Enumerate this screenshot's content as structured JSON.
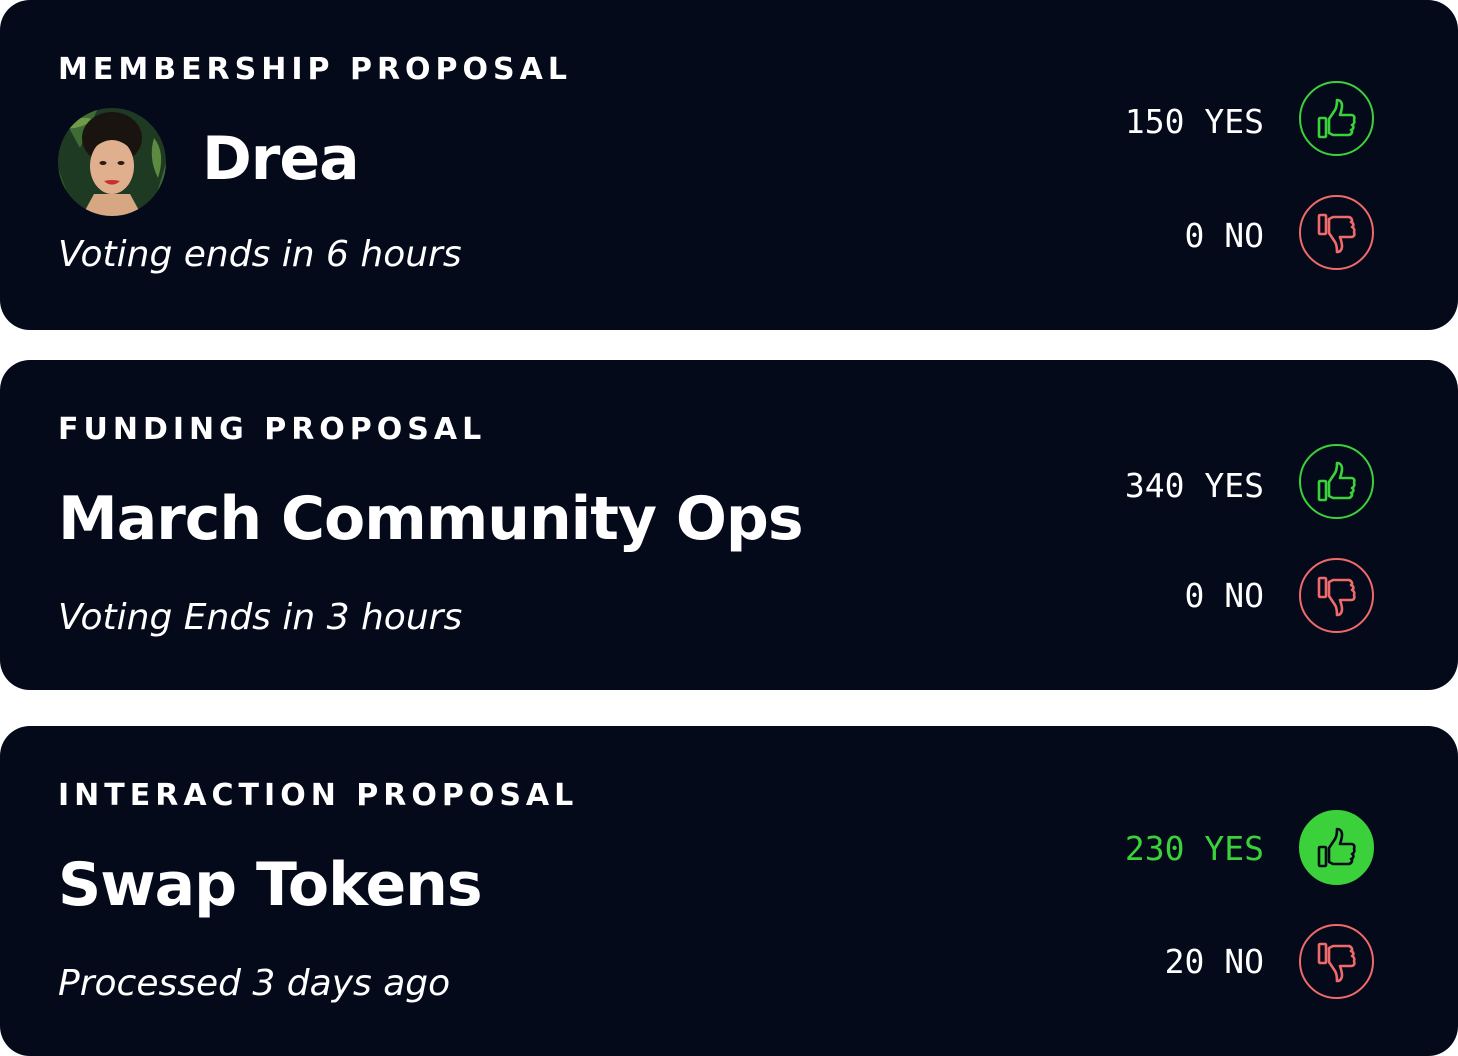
{
  "colors": {
    "card_bg": "#050a1a",
    "yes_accent": "#3bd13b",
    "no_accent": "#ef6a6a",
    "text": "#ffffff"
  },
  "proposals": [
    {
      "type": "MEMBERSHIP PROPOSAL",
      "title": "Drea",
      "status": "Voting ends in 6 hours",
      "has_avatar": true,
      "yes_label": "150 YES",
      "no_label": "0 NO",
      "yes_icon": "thumbs-up-icon",
      "no_icon": "thumbs-down-icon",
      "voted_yes": false
    },
    {
      "type": "FUNDING PROPOSAL",
      "title": "March Community Ops",
      "status": "Voting Ends in 3 hours",
      "has_avatar": false,
      "yes_label": "340 YES",
      "no_label": "0 NO",
      "yes_icon": "thumbs-up-icon",
      "no_icon": "thumbs-down-icon",
      "voted_yes": false
    },
    {
      "type": "INTERACTION PROPOSAL",
      "title": "Swap Tokens",
      "status": "Processed 3 days ago",
      "has_avatar": false,
      "yes_label": "230 YES",
      "no_label": "20 NO",
      "yes_icon": "thumbs-up-icon",
      "no_icon": "thumbs-down-icon",
      "voted_yes": true
    }
  ]
}
